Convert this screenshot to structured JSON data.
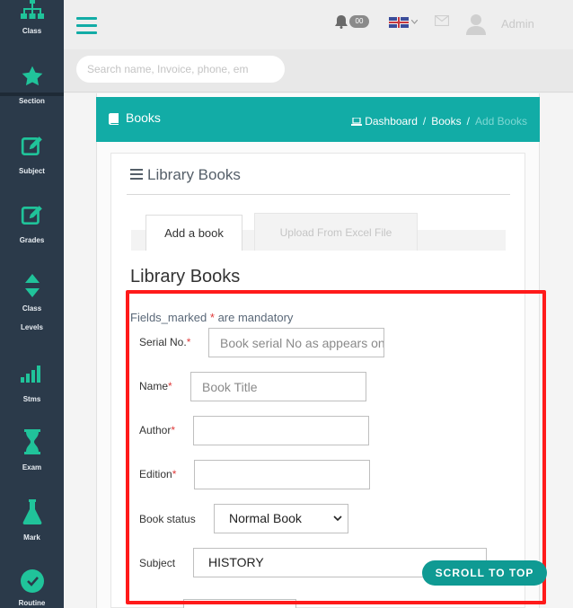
{
  "sidebar": {
    "items": [
      {
        "label": "Class",
        "icon": "sitemap-icon"
      },
      {
        "label": "Section",
        "icon": "star-icon"
      },
      {
        "label": "Subject",
        "icon": "edit-icon"
      },
      {
        "label": "Grades",
        "icon": "edit-icon"
      },
      {
        "label": "Class",
        "label2": "Levels",
        "icon": "sort-icon"
      },
      {
        "label": "Stms",
        "icon": "bar-chart-icon"
      },
      {
        "label": "Exam",
        "icon": "hourglass-icon"
      },
      {
        "label": "Mark",
        "icon": "flask-icon"
      },
      {
        "label": "Routine",
        "icon": "clock-icon"
      }
    ]
  },
  "topbar": {
    "notification_count": "00",
    "user_name": "Admin"
  },
  "search": {
    "placeholder": "Search name, Invoice, phone, em"
  },
  "page": {
    "title": "Books",
    "breadcrumb": [
      "Dashboard",
      "Books",
      "Add Books"
    ]
  },
  "panel": {
    "title": "Library Books",
    "tabs": [
      "Add a book",
      "Upload From Excel File"
    ],
    "form_heading": "Library Books",
    "mandatory_prefix": "Fields_marked",
    "mandatory_star": "*",
    "mandatory_suffix": "are mandatory"
  },
  "form": {
    "serial": {
      "label": "Serial No.",
      "placeholder": "Book serial No as appears on"
    },
    "name": {
      "label": "Name",
      "placeholder": "Book Title"
    },
    "author": {
      "label": "Author",
      "value": ""
    },
    "edition": {
      "label": "Edition",
      "value": ""
    },
    "status": {
      "label": "Book status",
      "value": "Normal Book"
    },
    "subject": {
      "label": "Subject",
      "value": "HISTORY"
    }
  },
  "scroll_top": {
    "label": "SCROLL TO TOP"
  },
  "colors": {
    "sidebar": "#2b3a4a",
    "accent": "#12aca6",
    "icon_green": "#20c39a",
    "highlight": "#ff1a1a"
  }
}
